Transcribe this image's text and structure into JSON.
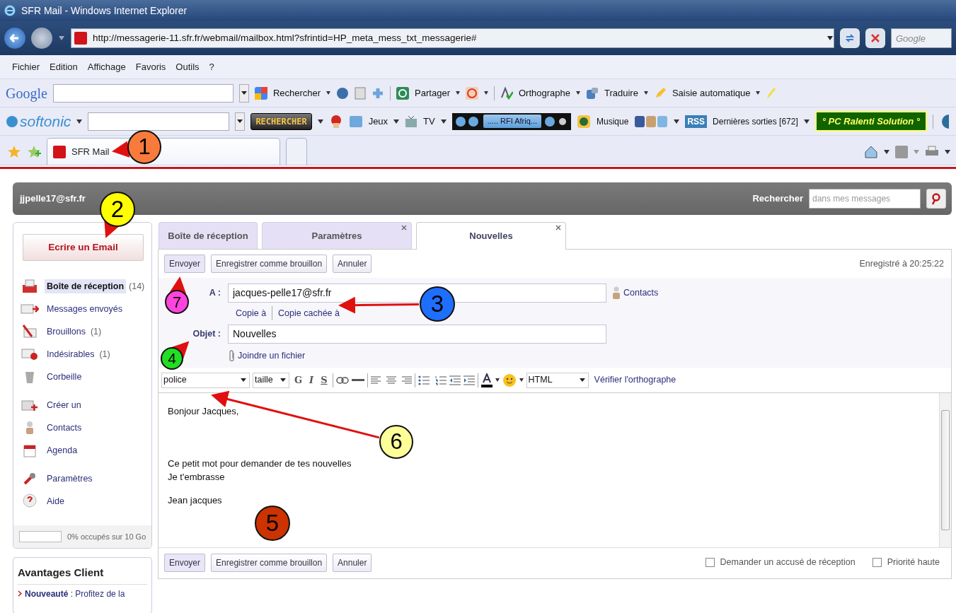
{
  "window": {
    "title": "SFR Mail - Windows Internet Explorer"
  },
  "address_bar": {
    "url": "http://messagerie-11.sfr.fr/webmail/mailbox.html?sfrintid=HP_meta_mess_txt_messagerie#",
    "search_placeholder": "Google"
  },
  "menu_bar": [
    "Fichier",
    "Edition",
    "Affichage",
    "Favoris",
    "Outils",
    "?"
  ],
  "google_toolbar": {
    "logo": "Google",
    "buttons": [
      "Rechercher",
      "Partager",
      "Orthographe",
      "Traduire",
      "Saisie automatique"
    ]
  },
  "softonic_toolbar": {
    "logo": "softonic",
    "search_button": "RECHERCHER",
    "buttons": [
      "Jeux",
      "TV"
    ],
    "radio_station": "..... RFI Afriq...",
    "music": "Musique",
    "rss": "RSS",
    "releases": "Dernières sorties [672]",
    "promo": "° PC Ralenti Solution °"
  },
  "browser_tabs": [
    {
      "label": "SFR Mail",
      "selected": true
    }
  ],
  "mail_header": {
    "account": "jjpelle17@sfr.fr",
    "search_label": "Rechercher",
    "search_placeholder": "dans mes messages"
  },
  "sidebar": {
    "compose_button": "Ecrire un Email",
    "items": [
      {
        "label": "Boîte de réception",
        "count": "(14)",
        "selected": true
      },
      {
        "label": "Messages envoyés",
        "selected": false
      },
      {
        "label": "Brouillons",
        "count": "(1)",
        "selected": false
      },
      {
        "label": "Indésirables",
        "count": "(1)",
        "selected": false
      },
      {
        "label": "Corbeille",
        "selected": false
      },
      {
        "label": "Créer un",
        "selected": false
      },
      {
        "label": "Contacts",
        "selected": false
      },
      {
        "label": "Agenda",
        "selected": false
      },
      {
        "label": "Paramètres",
        "selected": false
      },
      {
        "label": "Aide",
        "selected": false
      }
    ],
    "quota": {
      "level": 0,
      "text": "0% occupés sur 10 Go"
    }
  },
  "promo_panel": {
    "title": "Avantages Client",
    "text": "**Nouveauté** : Profitez de la"
  },
  "compose": {
    "tabs": [
      {
        "label": "Boîte de réception",
        "selected": false,
        "closable": false
      },
      {
        "label": "Paramètres",
        "selected": false,
        "closable": true
      },
      {
        "label": "Nouvelles",
        "selected": true,
        "closable": true
      }
    ],
    "top_actions": [
      "Envoyer",
      "Enregistrer comme brouillon",
      "Annuler"
    ],
    "saved_status": "Enregistré à 20:25:22",
    "to_label": "A :",
    "to_value": "jacques-pelle17@sfr.fr",
    "contacts_link": "Contacts",
    "cc_link": "Copie à",
    "bcc_link": "Copie cachée à",
    "subject_label": "Objet :",
    "subject_value": "Nouvelles",
    "attach_link": "Joindre un fichier",
    "editor_toolbar": {
      "font": "police",
      "size": "taille",
      "bold": "G",
      "italic": "I",
      "strike": "S",
      "format": "HTML",
      "spellcheck": "Vérifier l'orthographe"
    },
    "body": [
      "Bonjour Jacques,",
      "Ce petit mot pour demander de tes nouvelles",
      "Je t'embrasse",
      "Jean jacques"
    ],
    "bottom_actions": [
      "Envoyer",
      "Enregistrer comme brouillon",
      "Annuler"
    ],
    "options": [
      {
        "label": "Demander un accusé de réception",
        "checked": false
      },
      {
        "label": "Priorité haute",
        "checked": false
      }
    ]
  },
  "callouts": [
    {
      "number": "1",
      "color": "#f97b3c"
    },
    {
      "number": "2",
      "color": "#ffff00"
    },
    {
      "number": "3",
      "color": "#1e6fff"
    },
    {
      "number": "4",
      "color": "#22dd22"
    },
    {
      "number": "5",
      "color": "#cc3300"
    },
    {
      "number": "6",
      "color": "#ffff99"
    },
    {
      "number": "7",
      "color": "#ff44dd"
    }
  ]
}
